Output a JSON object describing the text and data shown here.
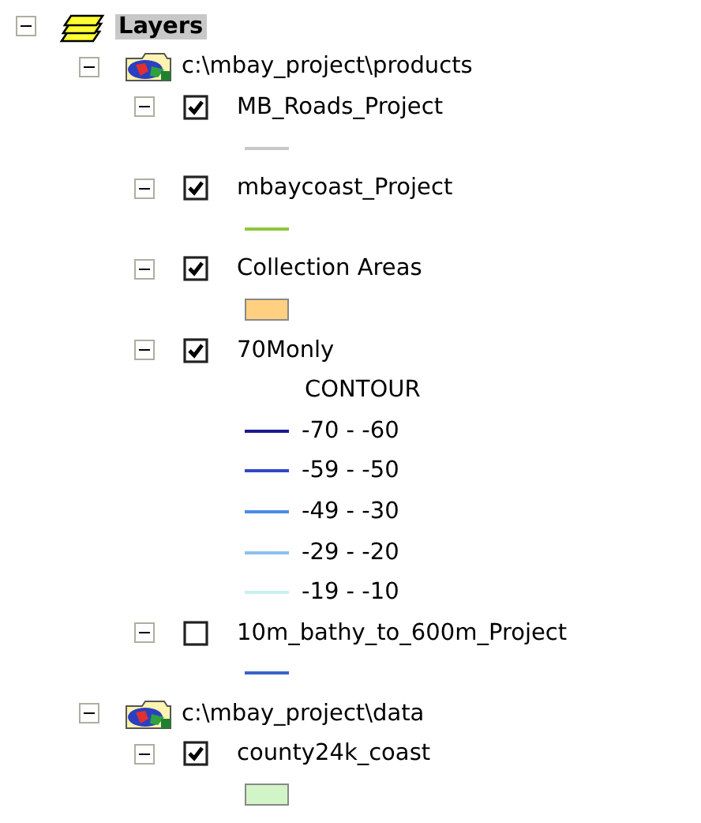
{
  "root": {
    "label": "Layers",
    "expanded": true,
    "selected": true
  },
  "groups": [
    {
      "path": "c:\\mbay_project\\products",
      "expanded": true,
      "layers": [
        {
          "name": "MB_Roads_Project",
          "expanded": true,
          "checked": true,
          "symbol": {
            "kind": "line",
            "color": "#c8c8c8"
          }
        },
        {
          "name": "mbaycoast_Project",
          "expanded": true,
          "checked": true,
          "symbol": {
            "kind": "line",
            "color": "#8cc83c"
          }
        },
        {
          "name": "Collection Areas",
          "expanded": true,
          "checked": true,
          "symbol": {
            "kind": "fill",
            "color": "#ffd080"
          }
        },
        {
          "name": "70Monly",
          "expanded": true,
          "checked": true,
          "heading": "CONTOUR",
          "classes": [
            {
              "label": "-70 - -60",
              "color": "#1a1a8c"
            },
            {
              "label": "-59 - -50",
              "color": "#3246c8"
            },
            {
              "label": "-49 - -30",
              "color": "#4a8ce6"
            },
            {
              "label": "-29 - -20",
              "color": "#8cc0f0"
            },
            {
              "label": "-19 - -10",
              "color": "#c8f0f0"
            }
          ]
        },
        {
          "name": "10m_bathy_to_600m_Project",
          "expanded": true,
          "checked": false,
          "symbol": {
            "kind": "line",
            "color": "#3c64c8"
          }
        }
      ]
    },
    {
      "path": "c:\\mbay_project\\data",
      "expanded": true,
      "layers": [
        {
          "name": "county24k_coast",
          "expanded": true,
          "checked": true,
          "symbol": {
            "kind": "fill",
            "color": "#d2f5c8"
          }
        }
      ]
    }
  ]
}
